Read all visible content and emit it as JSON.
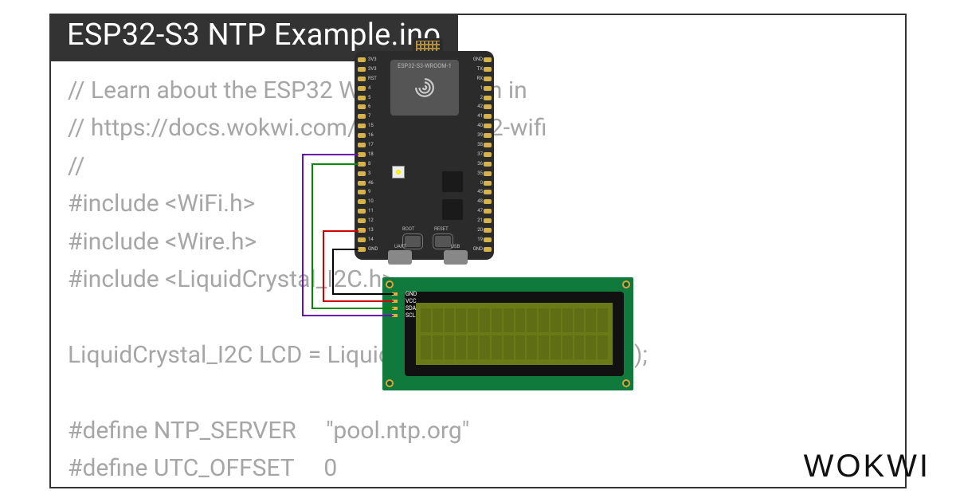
{
  "title": "ESP32-S3 NTP Example.ino",
  "brand": "WOKWI",
  "code_lines": [
    "// Learn about the ESP32 WiFi simulation in",
    "// https://docs.wokwi.com/guides/esp32-wifi",
    "//",
    "#include <WiFi.h>",
    "#include <Wire.h>",
    "#include <LiquidCrystal_I2C.h>",
    "",
    "LiquidCrystal_I2C LCD = LiquidCrystal_I2C(0x27, 16, 2);",
    "",
    "#define NTP_SERVER     \"pool.ntp.org\"",
    "#define UTC_OFFSET     0"
  ],
  "board": {
    "module_label": "ESP32-S3-WROOM-1",
    "left_btn_label": "BOOT",
    "right_btn_label": "RESET",
    "usb_left_label": "UART",
    "usb_right_label": "USB",
    "left_pins": [
      "3V3",
      "3V3",
      "RST",
      "4",
      "5",
      "6",
      "7",
      "15",
      "16",
      "17",
      "18",
      "8",
      "3",
      "46",
      "9",
      "10",
      "11",
      "12",
      "13",
      "14",
      "GND"
    ],
    "right_pins": [
      "GND",
      "TX",
      "RX",
      "1",
      "2",
      "42",
      "41",
      "40",
      "39",
      "38",
      "37",
      "36",
      "35",
      "0",
      "45",
      "48",
      "47",
      "21",
      "20",
      "19",
      "GND"
    ]
  },
  "lcd": {
    "pins": [
      "GND",
      "VCC",
      "SDA",
      "SCL"
    ],
    "cols": 16,
    "rows": 2
  },
  "wires": [
    {
      "name": "gnd",
      "color": "#000000"
    },
    {
      "name": "vcc",
      "color": "#d00000"
    },
    {
      "name": "sda",
      "color": "#008800"
    },
    {
      "name": "scl",
      "color": "#6a0dad"
    }
  ]
}
